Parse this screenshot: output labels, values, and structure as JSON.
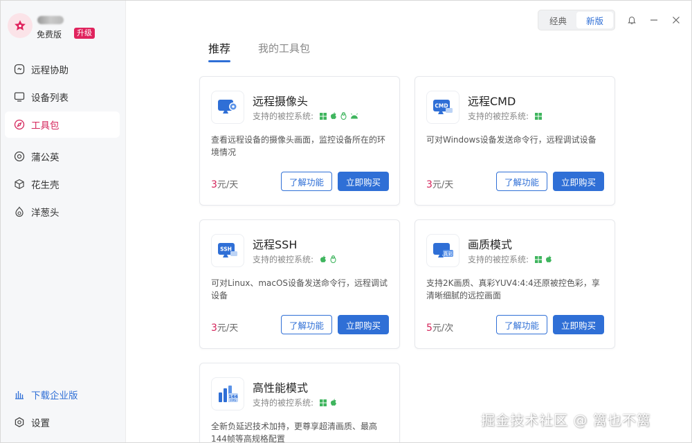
{
  "profile": {
    "plan": "免费版",
    "upgrade": "升级"
  },
  "nav": {
    "items": [
      {
        "label": "远程协助",
        "icon": "remote-assist-icon"
      },
      {
        "label": "设备列表",
        "icon": "monitor-icon"
      },
      {
        "label": "工具包",
        "icon": "compass-icon",
        "active": true
      },
      {
        "label": "蒲公英",
        "icon": "dandelion-icon"
      },
      {
        "label": "花生壳",
        "icon": "cube-icon"
      },
      {
        "label": "洋葱头",
        "icon": "onion-icon"
      }
    ],
    "bottom": [
      {
        "label": "下载企业版",
        "icon": "enterprise-icon"
      },
      {
        "label": "设置",
        "icon": "gear-icon"
      }
    ]
  },
  "version_toggle": {
    "classic": "经典",
    "new": "新版",
    "selected": "new"
  },
  "tabs": [
    {
      "label": "推荐",
      "active": true
    },
    {
      "label": "我的工具包",
      "active": false
    }
  ],
  "os_label": "支持的被控系统:",
  "buttons": {
    "learn": "了解功能",
    "buy": "立即购买"
  },
  "cards": [
    {
      "title": "远程摄像头",
      "icon": "camera-icon",
      "os": [
        "windows",
        "macos",
        "linux",
        "android"
      ],
      "desc": "查看远程设备的摄像头画面，监控设备所在的环境情况",
      "price": "3",
      "unit": "元/天"
    },
    {
      "title": "远程CMD",
      "icon": "cmd-icon",
      "os": [
        "windows"
      ],
      "desc": "可对Windows设备发送命令行，远程调试设备",
      "price": "3",
      "unit": "元/天"
    },
    {
      "title": "远程SSH",
      "icon": "ssh-icon",
      "os": [
        "macos",
        "linux"
      ],
      "desc": "可对Linux、macOS设备发送命令行，远程调试设备",
      "price": "3",
      "unit": "元/天"
    },
    {
      "title": "画质模式",
      "icon": "true-color-icon",
      "os": [
        "windows",
        "macos"
      ],
      "desc": "支持2K画质、真彩YUV4:4:4还原被控色彩，享清晰细腻的远控画面",
      "price": "5",
      "unit": "元/次"
    },
    {
      "title": "高性能模式",
      "icon": "fps-icon",
      "os": [
        "windows",
        "macos"
      ],
      "desc": "全新负延迟技术加持，更尊享超清画质、最高144帧等高规格配置",
      "price": "",
      "unit": ""
    }
  ],
  "icon_text": {
    "cmd": "CMD",
    "ssh": "SSH",
    "true_color": "真彩",
    "fps_num": "144",
    "fps_unit": "FPS"
  },
  "watermark": "掘金技术社区 @ 篱也不篱",
  "colors": {
    "accent": "#2f6fd6",
    "price": "#d4245a",
    "brand": "#e0245e"
  }
}
